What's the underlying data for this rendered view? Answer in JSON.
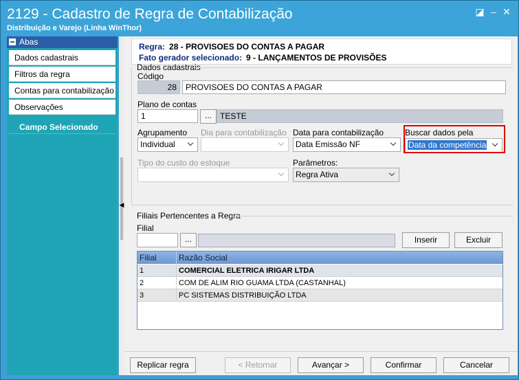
{
  "window": {
    "title": "2129 - Cadastro de Regra de Contabilização",
    "subtitle": "Distribuição e Varejo (Linha WinThor)"
  },
  "sidebar": {
    "header": "Abas",
    "items": [
      {
        "label": "Dados cadastrais"
      },
      {
        "label": "Filtros da regra"
      },
      {
        "label": "Contas para contabilização"
      },
      {
        "label": "Observações"
      }
    ],
    "campo_selecionado": "Campo Selecionado"
  },
  "info": {
    "regra_label": "Regra:",
    "regra_value": "28 - PROVISOES DO CONTAS A PAGAR",
    "fato_label": "Fato gerador selecionado:",
    "fato_value": "9 - LANÇAMENTOS DE PROVISÕES"
  },
  "dados": {
    "group_title": "Dados cadastrais",
    "codigo_label": "Código",
    "codigo_value": "28",
    "descricao_value": "PROVISOES DO CONTAS A PAGAR",
    "plano_label": "Plano de contas",
    "plano_value": "1",
    "plano_desc": "TESTE",
    "agrupamento_label": "Agrupamento",
    "agrupamento_value": "Individual",
    "dia_label": "Dia para contabilização",
    "dia_value": "",
    "data_label": "Data para contabilização",
    "data_value": "Data Emissão NF",
    "buscar_label": "Buscar dados pela",
    "buscar_value": "Data da competência",
    "tipo_custo_label": "Tipo do custo do estoque",
    "tipo_custo_value": "",
    "parametros_label": "Parâmetros:",
    "parametros_value": "Regra Ativa"
  },
  "filiais": {
    "group_title": "Filiais Pertencentes a Regra",
    "filial_label": "Filial",
    "filial_value": "",
    "inserir": "Inserir",
    "excluir": "Excluir",
    "columns": [
      "Filial",
      "Razão Social"
    ],
    "rows": [
      {
        "filial": "1",
        "razao": "COMERCIAL ELETRICA IRIGAR LTDA"
      },
      {
        "filial": "2",
        "razao": "COM DE ALIM RIO GUAMA LTDA (CASTANHAL)"
      },
      {
        "filial": "3",
        "razao": "PC SISTEMAS DISTRIBUIÇÃO LTDA"
      }
    ]
  },
  "footer": {
    "replicar": "Replicar regra",
    "retornar": "< Retornar",
    "avancar": "Avançar >",
    "confirmar": "Confirmar",
    "cancelar": "Cancelar"
  },
  "icons": {
    "dots_button": "..."
  }
}
